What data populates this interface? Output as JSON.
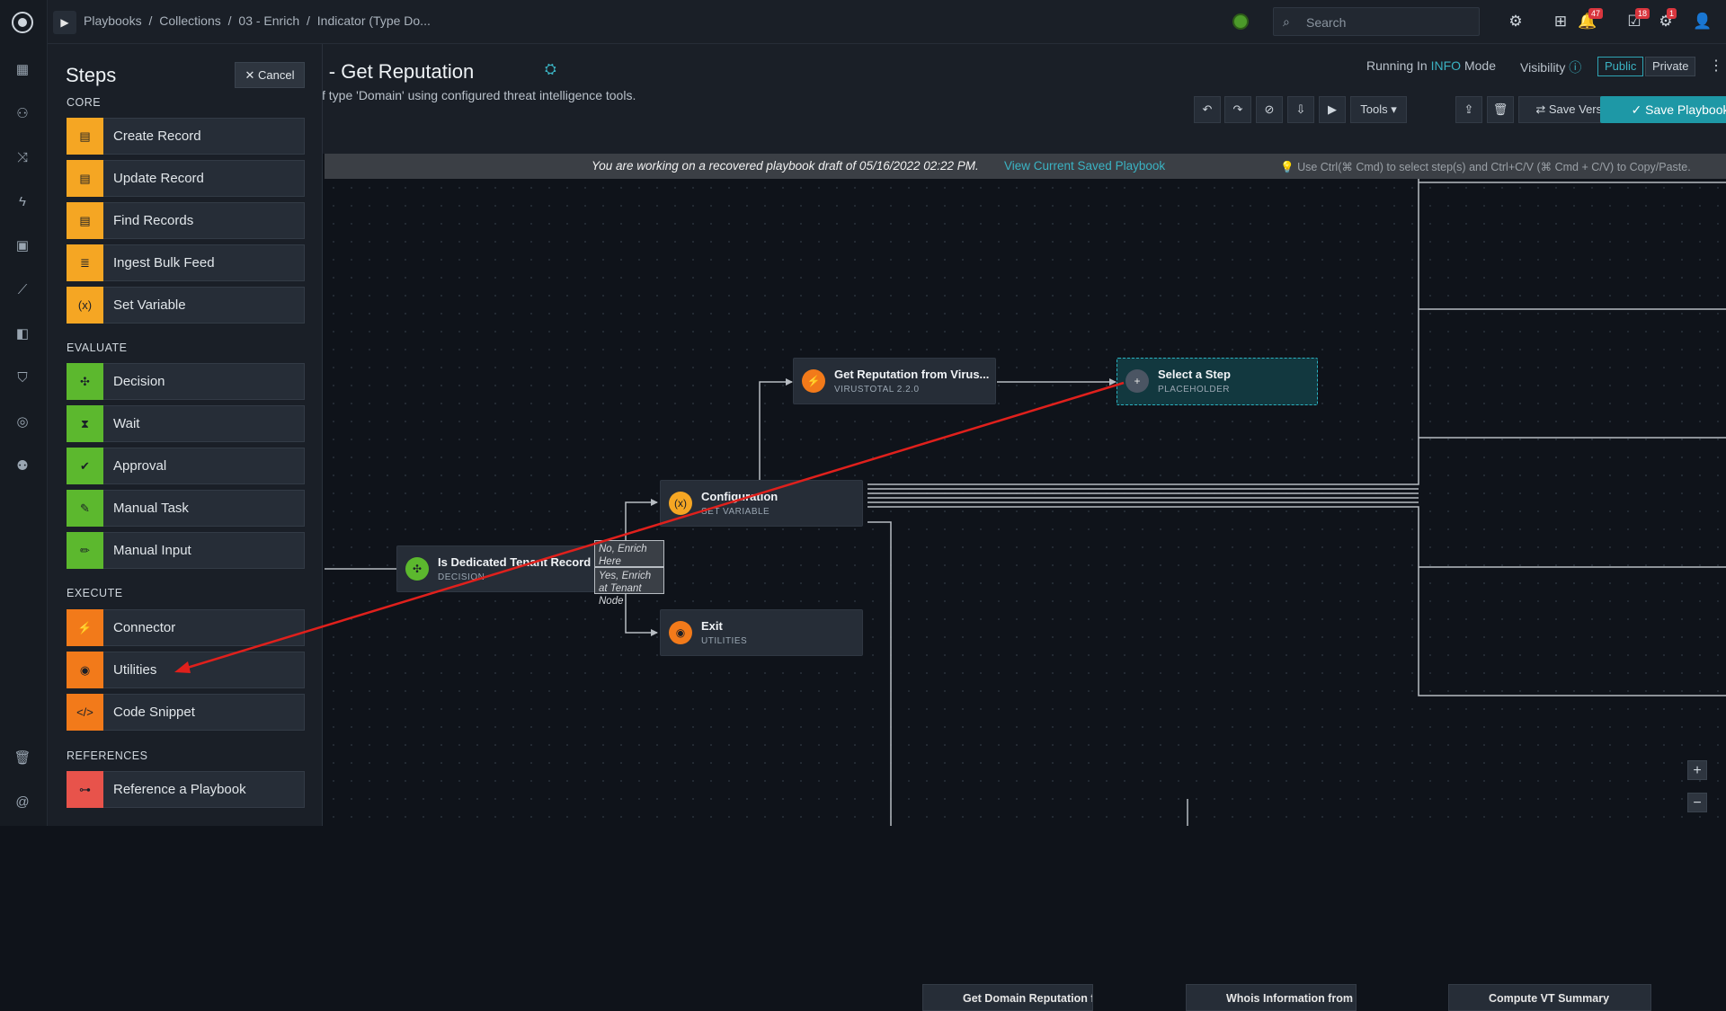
{
  "breadcrumb": [
    "Playbooks",
    "/",
    "Collections",
    "/",
    "03 - Enrich",
    "/",
    "Indicator (Type Do..."
  ],
  "search": {
    "placeholder": "Search"
  },
  "badges": {
    "notifications": "47",
    "tasks": "18",
    "queue": "1"
  },
  "playbook": {
    "title": "ain) - Get Reputation",
    "description": "tors of type 'Domain' using configured threat intelligence tools."
  },
  "mode": {
    "prefix": "Running In",
    "level": "INFO",
    "suffix": "Mode"
  },
  "visibility": {
    "label": "Visibility",
    "public": "Public",
    "private": "Private"
  },
  "toolbar": {
    "tools": "Tools",
    "save_version": "Save Version",
    "save_playbook": "Save Playbook"
  },
  "draft": {
    "message": "You are working on a recovered playbook draft of 05/16/2022 02:22 PM.",
    "link": "View Current Saved Playbook",
    "tip": "Use Ctrl(⌘ Cmd) to select step(s) and Ctrl+C/V (⌘ Cmd + C/V) to Copy/Paste."
  },
  "steps_panel": {
    "title": "Steps",
    "cancel": "Cancel",
    "sections": {
      "core": "CORE",
      "evaluate": "EVALUATE",
      "execute": "EXECUTE",
      "references": "REFERENCES"
    },
    "core_items": [
      "Create Record",
      "Update Record",
      "Find Records",
      "Ingest Bulk Feed",
      "Set Variable"
    ],
    "evaluate_items": [
      "Decision",
      "Wait",
      "Approval",
      "Manual Task",
      "Manual Input"
    ],
    "execute_items": [
      "Connector",
      "Utilities",
      "Code Snippet"
    ],
    "references_items": [
      "Reference a Playbook"
    ]
  },
  "nodes": {
    "virustotal": {
      "title": "Get Reputation from Virus...",
      "sub": "VIRUSTOTAL 2.2.0"
    },
    "placeholder": {
      "title": "Select a Step",
      "sub": "PLACEHOLDER"
    },
    "configuration": {
      "title": "Configuration",
      "sub": "SET VARIABLE"
    },
    "decision": {
      "title": "Is Dedicated Tenant Record",
      "sub": "DECISION"
    },
    "exit": {
      "title": "Exit",
      "sub": "UTILITIES"
    },
    "cond_no": "No, Enrich Here",
    "cond_yes": "Yes, Enrich at Tenant Node"
  },
  "bottom_nodes": [
    "Get Domain Reputation fr...",
    "Whois Information from VT...",
    "Compute VT Summary"
  ],
  "colors": {
    "accent": "#1e98a6",
    "core": "#f5a623",
    "evaluate": "#5cb82e",
    "execute": "#f27a1a",
    "reference": "#e8534b",
    "arrow": "#e0201c"
  }
}
